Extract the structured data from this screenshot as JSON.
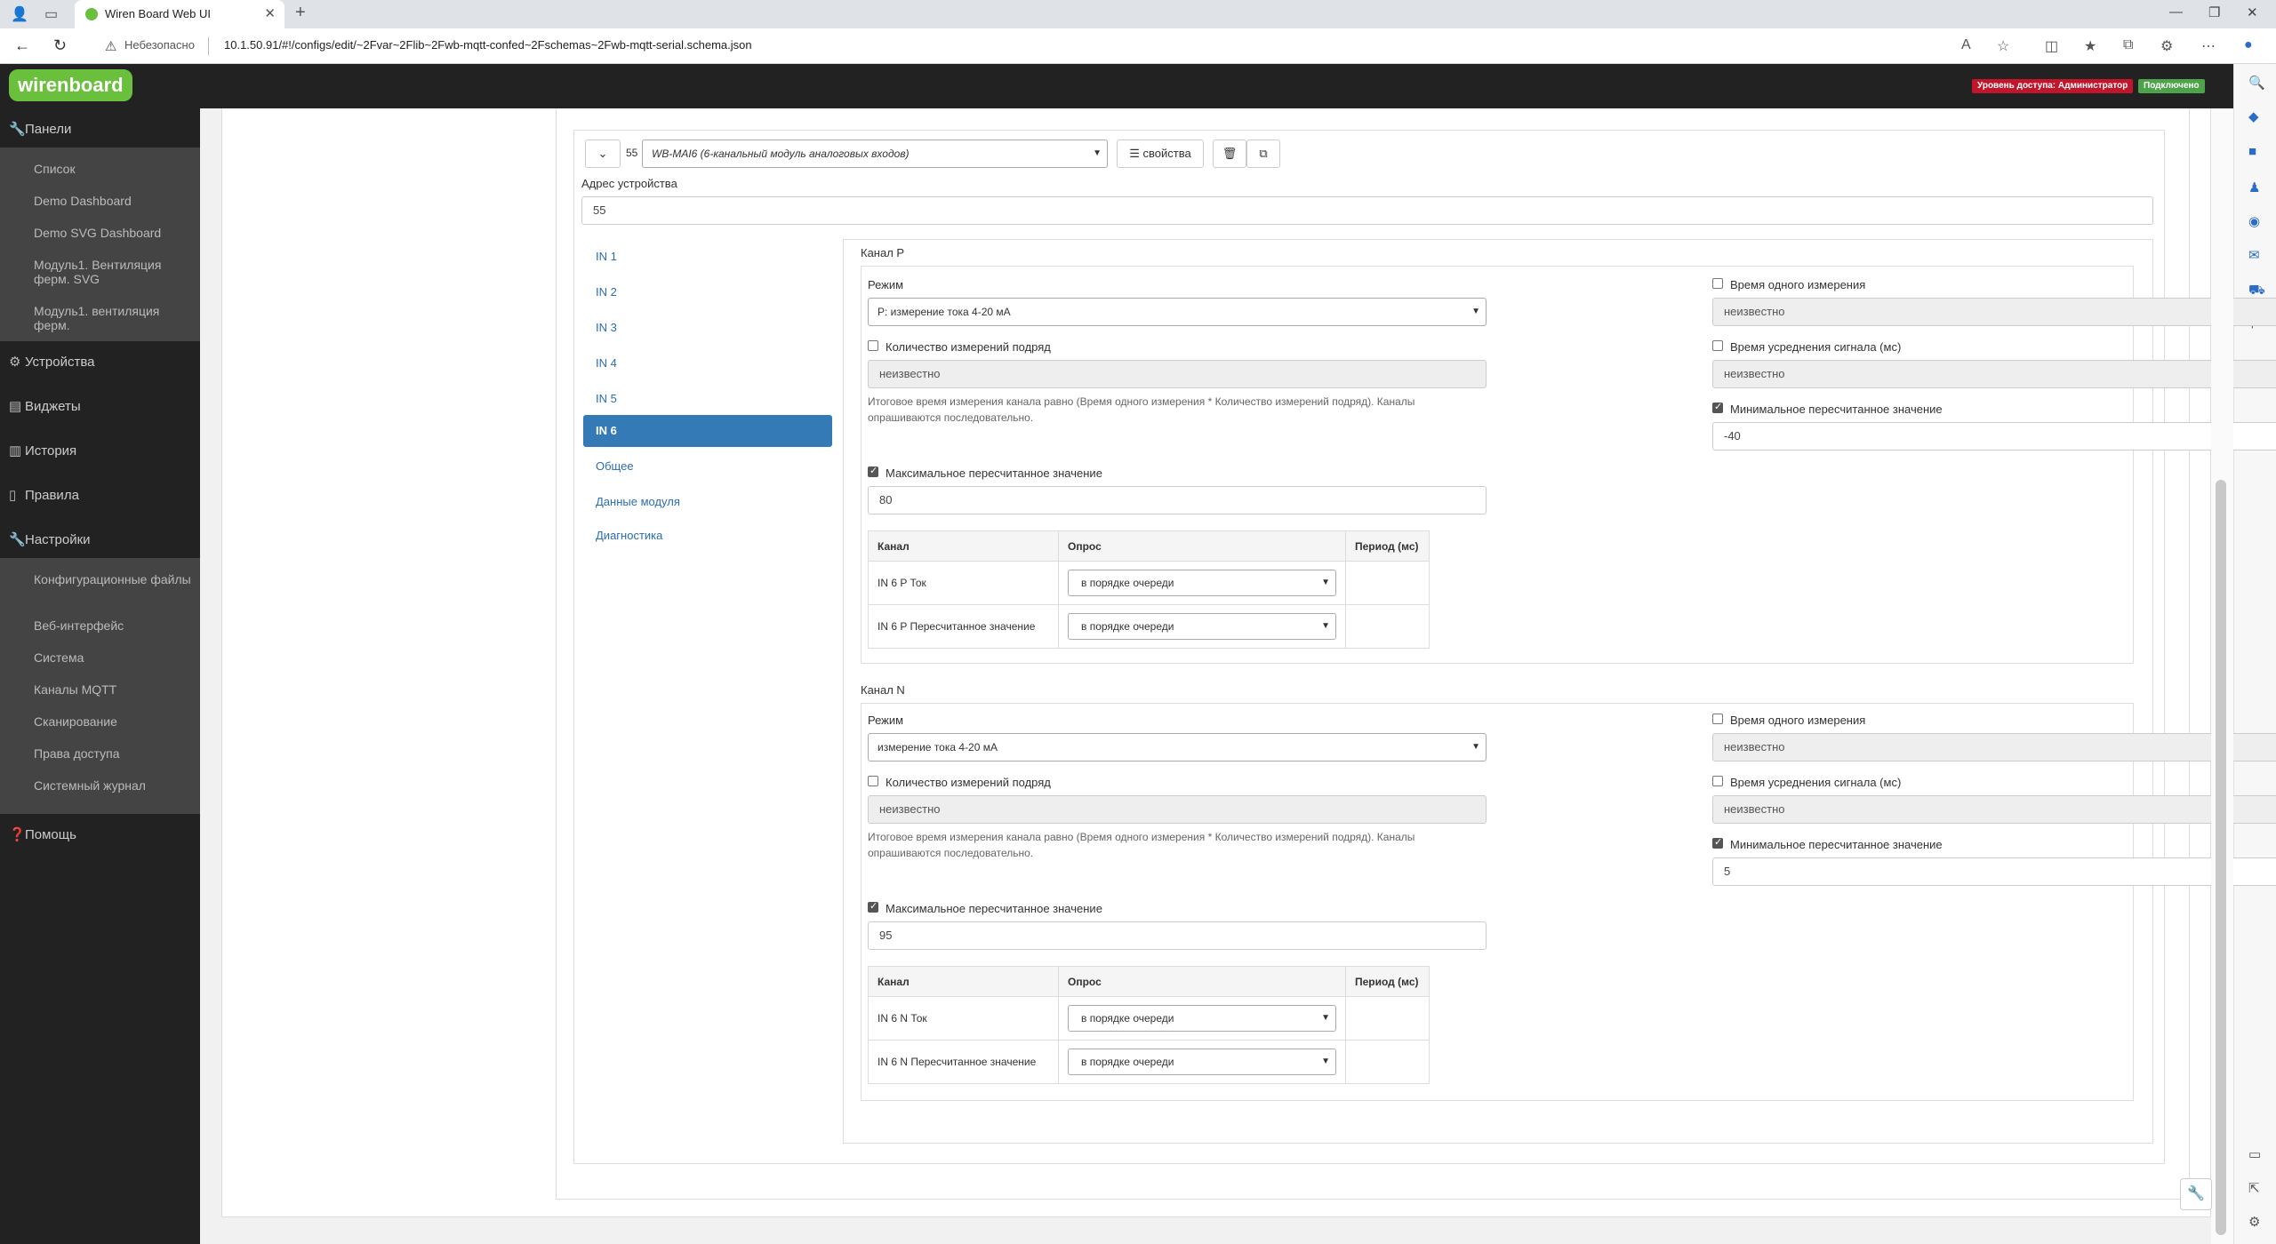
{
  "browser": {
    "tab_title": "Wiren Board Web UI",
    "insecure_label": "Небезопасно",
    "url": "10.1.50.91/#!/configs/edit/~2Fvar~2Flib~2Fwb-mqtt-confed~2Fschemas~2Fwb-mqtt-serial.schema.json"
  },
  "header": {
    "logo": "wirenboard",
    "access_badge": "Уровень доступа: Администратор",
    "connection_badge": "Подключено"
  },
  "sidebar": {
    "panels": "Панели",
    "panel_items": [
      "Список",
      "Demo Dashboard",
      "Demo SVG Dashboard",
      "Модуль1. Вентиляция ферм. SVG",
      "Модуль1. вентиляция ферм."
    ],
    "devices": "Устройства",
    "widgets": "Виджеты",
    "history": "История",
    "rules": "Правила",
    "settings": "Настройки",
    "settings_items": [
      "Конфигурационные файлы",
      "Веб-интерфейс",
      "Система",
      "Каналы MQTT",
      "Сканирование",
      "Права доступа",
      "Системный журнал"
    ],
    "help": "Помощь"
  },
  "device": {
    "number": "55",
    "model": "WB-MAI6 (6-канальный модуль аналоговых входов)",
    "properties_button": "свойства",
    "address_label": "Адрес устройства",
    "address_value": "55"
  },
  "nav": [
    "IN 1",
    "IN 2",
    "IN 3",
    "IN 4",
    "IN 5",
    "IN 6",
    "Общее",
    "Данные модуля",
    "Диагностика"
  ],
  "nav_active": "IN 6",
  "labels": {
    "mode": "Режим",
    "single_time": "Время одного измерения",
    "count": "Количество измерений подряд",
    "avg_time": "Время усреднения сигнала (мс)",
    "min_value": "Минимальное пересчитанное значение",
    "max_value": "Максимальное пересчитанное значение",
    "hint": "Итоговое время измерения канала равно (Время одного измерения * Количество измерений подряд). Каналы опрашиваются последовательно.",
    "unknown": "неизвестно",
    "col_channel": "Канал",
    "col_poll": "Опрос",
    "col_period": "Период (мс)"
  },
  "channels": {
    "p": {
      "title": "Канал P",
      "mode": "P: измерение тока 4-20 мА",
      "min": "-40",
      "max": "80",
      "row1": "IN 6 P Ток",
      "row2": "IN 6 P Пересчитанное значение",
      "poll": "в порядке очереди"
    },
    "n": {
      "title": "Канал N",
      "mode": "измерение тока 4-20 мА",
      "min": "5",
      "max": "95",
      "row1": "IN 6 N Ток",
      "row2": "IN 6 N Пересчитанное значение",
      "poll": "в порядке очереди"
    }
  },
  "colors": {
    "accent": "#337ab7",
    "brand": "#6abf3c",
    "header_bg": "#222222",
    "admin_badge": "#c0152b",
    "connected_badge": "#4ca34a"
  }
}
